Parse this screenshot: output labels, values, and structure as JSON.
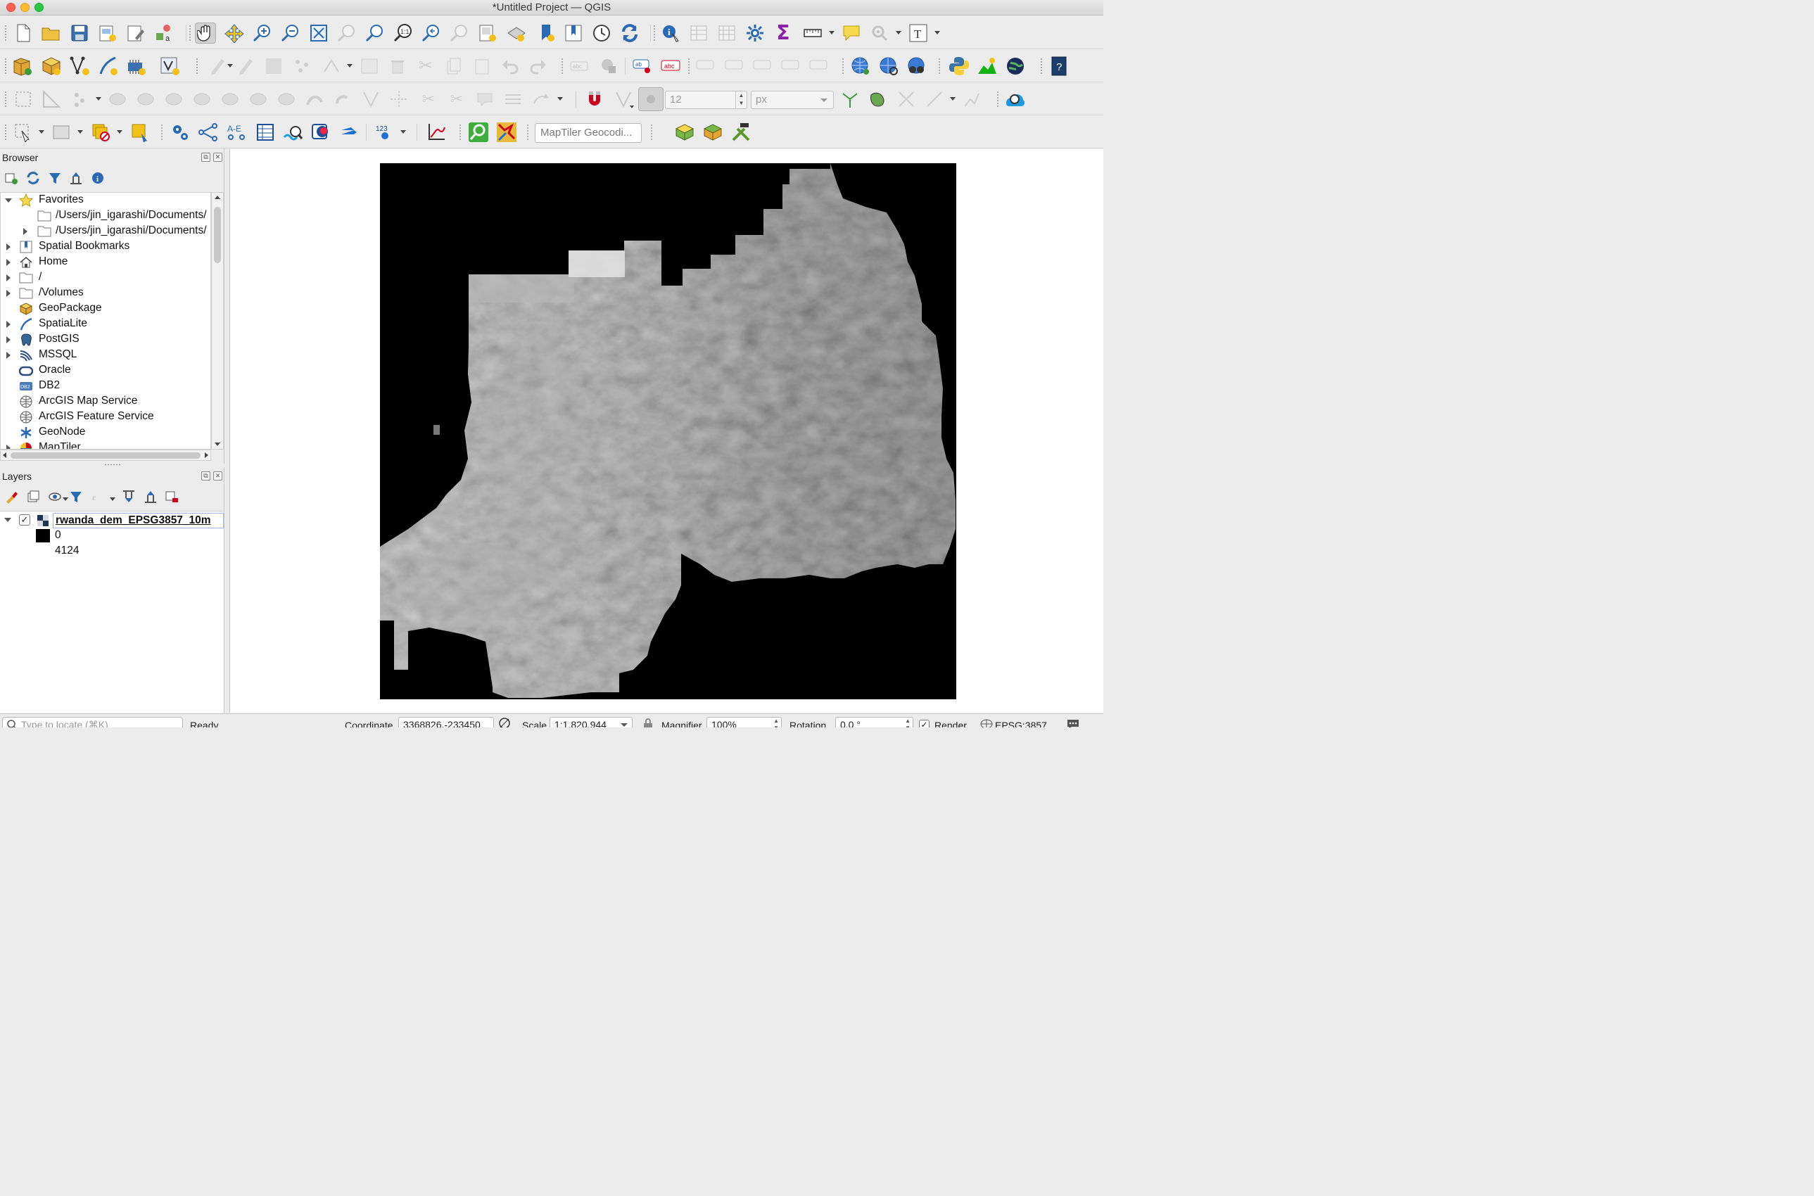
{
  "window": {
    "title": "*Untitled Project — QGIS"
  },
  "colors": {
    "accent": "#1e73d2",
    "selection_border": "#9bb7e2",
    "raster_bg": "#000000"
  },
  "toolbars": {
    "project": [
      "new-project-icon",
      "open-project-icon",
      "save-project-icon",
      "new-print-layout-icon",
      "layout-manager-icon",
      "style-manager-icon"
    ],
    "navigation": [
      "pan-icon",
      "pan-to-selection-icon",
      "zoom-in-icon",
      "zoom-out-icon",
      "zoom-full-icon",
      "zoom-to-selection-icon",
      "zoom-to-layer-icon",
      "zoom-native-icon",
      "zoom-last-icon",
      "zoom-next-icon",
      "new-map-view-icon",
      "new-3d-map-view-icon",
      "new-bookmark-icon",
      "show-bookmarks-icon",
      "temporal-controller-icon",
      "refresh-icon"
    ],
    "attributes": [
      "identify-icon",
      "open-attribute-table-icon",
      "open-field-calculator-icon",
      "toolbox-icon",
      "statistical-summary-icon",
      "measure-icon",
      "map-tips-icon",
      "annotation-icon",
      "text-annotation-icon"
    ],
    "snapping": {
      "tolerance_value": "12",
      "tolerance_unit": "px"
    },
    "geocoder": {
      "placeholder": "MapTiler Geocodi..."
    }
  },
  "browser": {
    "title": "Browser",
    "items": [
      {
        "label": "Favorites",
        "icon": "star-icon",
        "expanded": true,
        "indent": 0
      },
      {
        "label": "/Users/jin_igarashi/Documents/",
        "icon": "folder-icon",
        "indent": 1,
        "has_arrow": false
      },
      {
        "label": "/Users/jin_igarashi/Documents/",
        "icon": "folder-icon",
        "indent": 1,
        "has_arrow": true
      },
      {
        "label": "Spatial Bookmarks",
        "icon": "bookmark-icon",
        "indent": 0
      },
      {
        "label": "Home",
        "icon": "home-icon",
        "indent": 0
      },
      {
        "label": "/",
        "icon": "folder-icon",
        "indent": 0
      },
      {
        "label": "/Volumes",
        "icon": "folder-icon",
        "indent": 0
      },
      {
        "label": "GeoPackage",
        "icon": "geopackage-icon",
        "indent": 0
      },
      {
        "label": "SpatiaLite",
        "icon": "spatialite-icon",
        "indent": 0
      },
      {
        "label": "PostGIS",
        "icon": "postgis-icon",
        "indent": 0
      },
      {
        "label": "MSSQL",
        "icon": "mssql-icon",
        "indent": 0
      },
      {
        "label": "Oracle",
        "icon": "oracle-icon",
        "indent": 0
      },
      {
        "label": "DB2",
        "icon": "db2-icon",
        "indent": 0
      },
      {
        "label": "ArcGIS Map Service",
        "icon": "arcgis-icon",
        "indent": 0
      },
      {
        "label": "ArcGIS Feature Service",
        "icon": "arcgis-icon",
        "indent": 0
      },
      {
        "label": "GeoNode",
        "icon": "geonode-icon",
        "indent": 0
      },
      {
        "label": "MapTiler",
        "icon": "maptiler-icon",
        "indent": 0
      }
    ]
  },
  "layers": {
    "title": "Layers",
    "layer_name": "rwanda_dem_EPSG3857_10m",
    "legend_min": "0",
    "legend_max": "4124"
  },
  "statusbar": {
    "locator_placeholder": "Type to locate (⌘K)",
    "status": "Ready",
    "coordinate_label": "Coordinate",
    "coordinate_value": "3368826,-233450",
    "scale_label": "Scale",
    "scale_value": "1:1,820,944",
    "magnifier_label": "Magnifier",
    "magnifier_value": "100%",
    "rotation_label": "Rotation",
    "rotation_value": "0.0 °",
    "render_label": "Render",
    "crs_label": "EPSG:3857"
  }
}
